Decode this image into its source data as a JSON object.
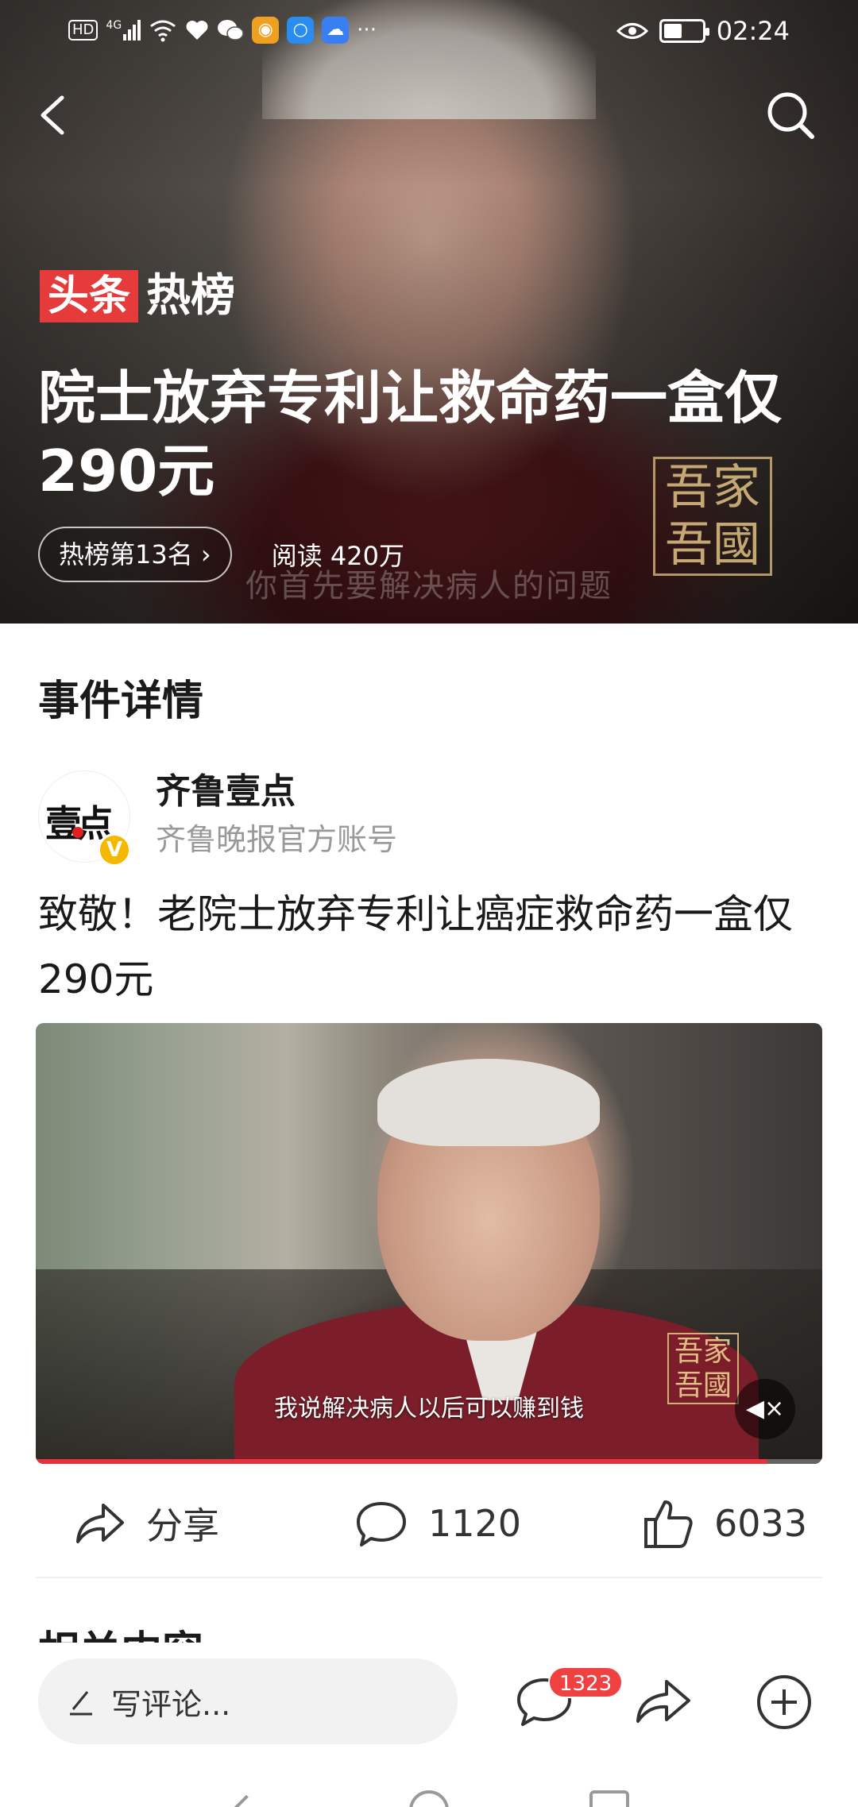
{
  "status_bar": {
    "left_icons": [
      "hd-icon",
      "4g-signal-icon",
      "wifi-icon",
      "health-icon",
      "wechat-icon",
      "weibo-icon",
      "search-app-icon",
      "cloud-icon",
      "more-dots-icon"
    ],
    "network_label": "4G",
    "hd_label": "HD",
    "more_label": "···",
    "time": "02:24"
  },
  "hero": {
    "brand_red": "头条",
    "brand_white": "热榜",
    "title": "院士放弃专利让救命药一盒仅290元",
    "rank_label": "热榜第13名",
    "reads_label": "阅读 420万",
    "subtitle_overlay": "你首先要解决病人的问题",
    "seal_text": "吾家吾國"
  },
  "details": {
    "section_title": "事件详情",
    "author": {
      "name": "齐鲁壹点",
      "description": "齐鲁晚报官方账号",
      "avatar_text": "壹点",
      "verified_label": "V"
    },
    "post_text": "致敬！老院士放弃专利让癌症救命药一盒仅290元",
    "video": {
      "caption": "我说解决病人以后可以赚到钱",
      "seal_text": "吾家吾國",
      "mute_label": "◀×",
      "progress": 0.93
    },
    "actions": {
      "share_label": "分享",
      "comments_count": "1120",
      "likes_count": "6033"
    },
    "related_title_peek": "相关内容"
  },
  "bottom_bar": {
    "comment_placeholder": "写评论...",
    "comment_badge": "1323"
  },
  "colors": {
    "brand_red": "#e63b3b",
    "badge_red": "#f04142",
    "verified_yellow": "#f5b800",
    "progress_red": "#e8323b"
  }
}
